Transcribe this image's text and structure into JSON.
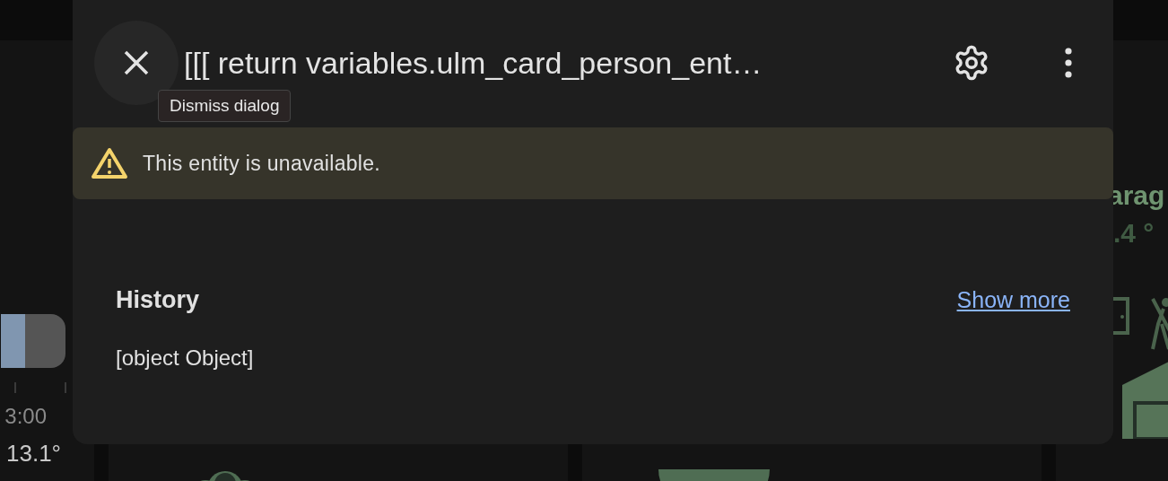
{
  "background": {
    "left_card": {
      "bar": {
        "level": 0.38
      },
      "time": "3:00",
      "temperature": "13.1°"
    },
    "right_card": {
      "name": "arag",
      "temperature": ".4 °"
    }
  },
  "dialog": {
    "title": "[[[ return variables.ulm_card_person_ent…",
    "tooltip": "Dismiss dialog",
    "warning": "This entity is unavailable.",
    "history": {
      "heading": "History",
      "link": "Show more",
      "content": "[object Object]"
    }
  }
}
